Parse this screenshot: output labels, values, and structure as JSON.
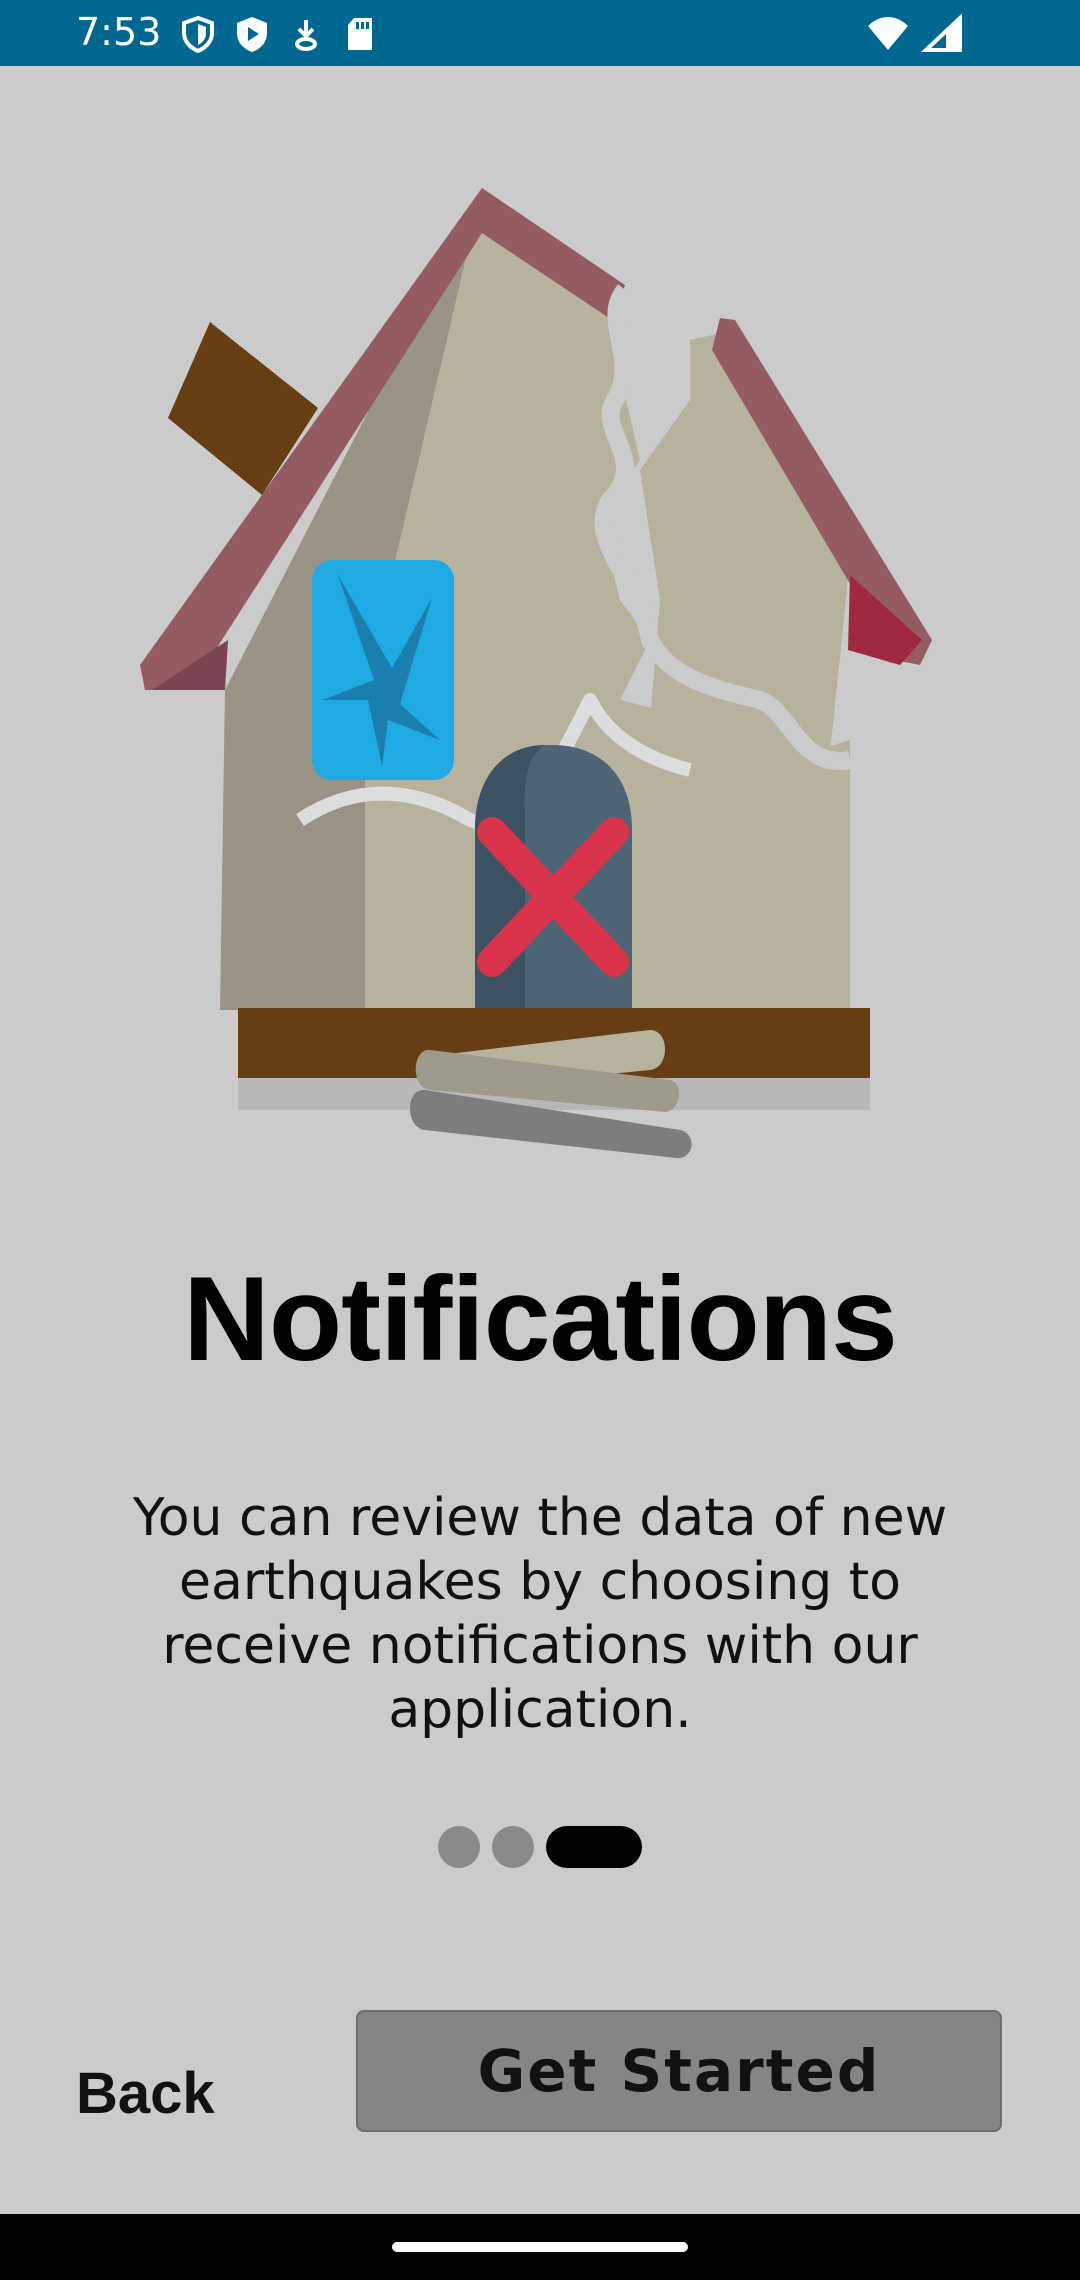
{
  "status_bar": {
    "time": "7:53",
    "icons": [
      "shield-outline-icon",
      "play-shield-icon",
      "download-icon",
      "sd-card-icon"
    ],
    "right_icons": [
      "wifi-icon",
      "signal-icon"
    ],
    "background": "#006890"
  },
  "illustration": {
    "icon": "damaged-house-icon"
  },
  "onboarding": {
    "title": "Notifications",
    "description": "You can review the data of new earthquakes by choosing to receive notifications with our application.",
    "page_count": 3,
    "current_page": 3
  },
  "buttons": {
    "back_label": "Back",
    "get_started_label": "Get Started"
  }
}
